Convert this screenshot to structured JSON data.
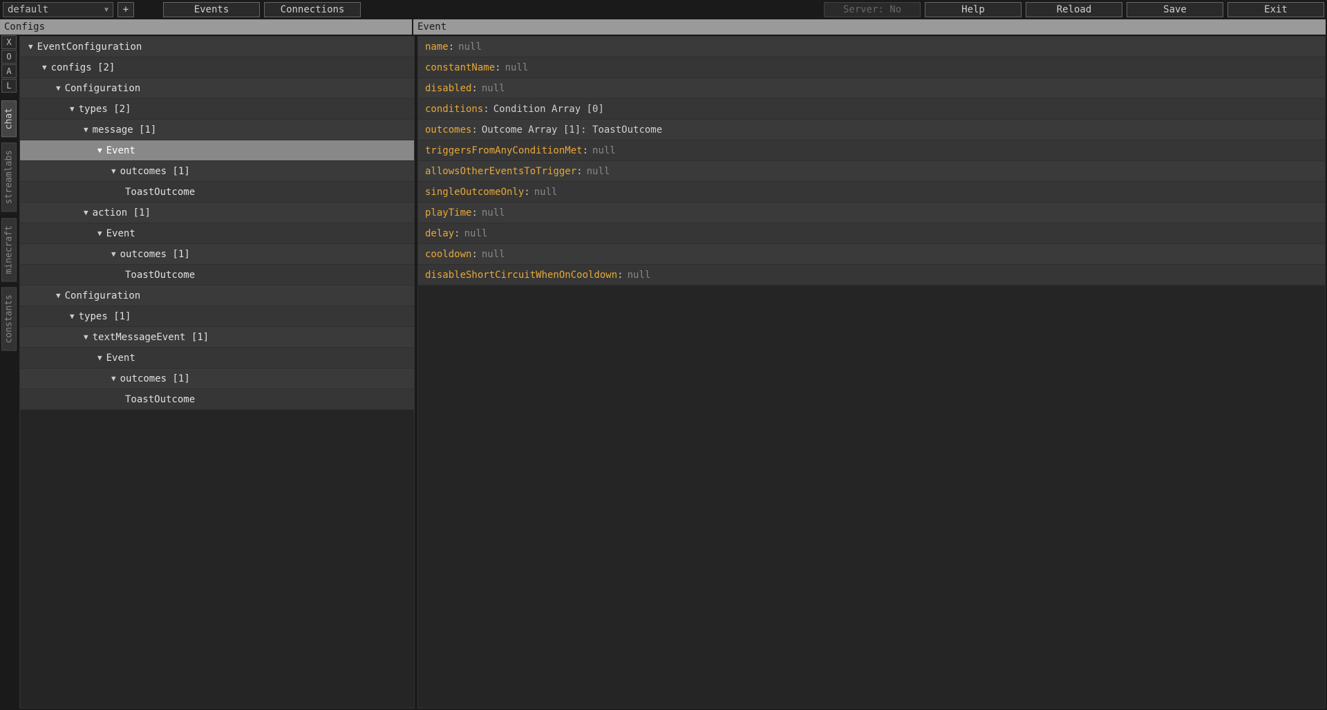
{
  "toolbar": {
    "dropdown_value": "default",
    "add_label": "+",
    "events_label": "Events",
    "connections_label": "Connections",
    "server_label": "Server: No",
    "help_label": "Help",
    "reload_label": "Reload",
    "save_label": "Save",
    "exit_label": "Exit"
  },
  "panels": {
    "left_title": "Configs",
    "right_title": "Event"
  },
  "mini_buttons": [
    "X",
    "O",
    "A",
    "L"
  ],
  "vtabs": [
    {
      "label": "chat",
      "active": true
    },
    {
      "label": "streamlabs",
      "active": false
    },
    {
      "label": "minecraft",
      "active": false
    },
    {
      "label": "constants",
      "active": false
    }
  ],
  "tree": [
    {
      "indent": 0,
      "arrow": true,
      "label": "EventConfiguration",
      "selected": false
    },
    {
      "indent": 1,
      "arrow": true,
      "label": "configs [2]",
      "selected": false
    },
    {
      "indent": 2,
      "arrow": true,
      "label": "Configuration",
      "selected": false
    },
    {
      "indent": 3,
      "arrow": true,
      "label": "types [2]",
      "selected": false
    },
    {
      "indent": 4,
      "arrow": true,
      "label": "message [1]",
      "selected": false
    },
    {
      "indent": 5,
      "arrow": true,
      "label": "Event",
      "selected": true
    },
    {
      "indent": 6,
      "arrow": true,
      "label": "outcomes [1]",
      "selected": false
    },
    {
      "indent": 7,
      "arrow": false,
      "label": "ToastOutcome",
      "selected": false
    },
    {
      "indent": 4,
      "arrow": true,
      "label": "action [1]",
      "selected": false
    },
    {
      "indent": 5,
      "arrow": true,
      "label": "Event",
      "selected": false
    },
    {
      "indent": 6,
      "arrow": true,
      "label": "outcomes [1]",
      "selected": false
    },
    {
      "indent": 7,
      "arrow": false,
      "label": "ToastOutcome",
      "selected": false
    },
    {
      "indent": 2,
      "arrow": true,
      "label": "Configuration",
      "selected": false
    },
    {
      "indent": 3,
      "arrow": true,
      "label": "types [1]",
      "selected": false
    },
    {
      "indent": 4,
      "arrow": true,
      "label": "textMessageEvent [1]",
      "selected": false
    },
    {
      "indent": 5,
      "arrow": true,
      "label": "Event",
      "selected": false
    },
    {
      "indent": 6,
      "arrow": true,
      "label": "outcomes [1]",
      "selected": false
    },
    {
      "indent": 7,
      "arrow": false,
      "label": "ToastOutcome",
      "selected": false
    }
  ],
  "properties": [
    {
      "key": "name",
      "value": "null",
      "null": true
    },
    {
      "key": "constantName",
      "value": "null",
      "null": true
    },
    {
      "key": "disabled",
      "value": "null",
      "null": true
    },
    {
      "key": "conditions",
      "value": "Condition Array [0]",
      "null": false
    },
    {
      "key": "outcomes",
      "value": "Outcome Array [1]: ToastOutcome",
      "null": false
    },
    {
      "key": "triggersFromAnyConditionMet",
      "value": "null",
      "null": true
    },
    {
      "key": "allowsOtherEventsToTrigger",
      "value": "null",
      "null": true
    },
    {
      "key": "singleOutcomeOnly",
      "value": "null",
      "null": true
    },
    {
      "key": "playTime",
      "value": "null",
      "null": true
    },
    {
      "key": "delay",
      "value": "null",
      "null": true
    },
    {
      "key": "cooldown",
      "value": "null",
      "null": true
    },
    {
      "key": "disableShortCircuitWhenOnCooldown",
      "value": "null",
      "null": true
    }
  ]
}
